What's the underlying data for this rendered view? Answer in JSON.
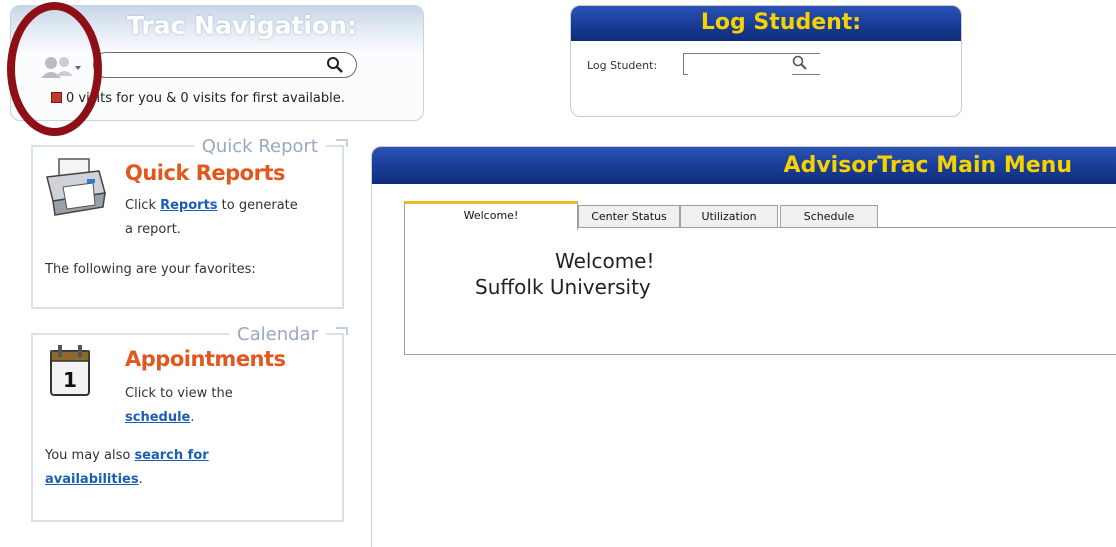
{
  "trac_nav": {
    "title": "Trac Navigation:",
    "search": {
      "value": "",
      "placeholder": ""
    },
    "visits_text": "0 visits for you & 0 visits for first available."
  },
  "log_student": {
    "title": "Log Student:",
    "label": "Log Student:",
    "input": {
      "value": "",
      "placeholder": ""
    }
  },
  "quick_report": {
    "legend": "Quick Report",
    "heading": "Quick Reports",
    "line1_pre": "Click ",
    "link": "Reports",
    "line1_post": " to generate",
    "line2": "a report.",
    "favorites": "The following are your favorites:"
  },
  "calendar": {
    "legend": "Calendar",
    "heading": "Appointments",
    "icon_day": "1",
    "line1": "Click to view the",
    "link_schedule": "schedule",
    "period": ".",
    "also_pre": "You may also ",
    "link_search_1": "search for",
    "link_search_2": "availabilities",
    "period2": "."
  },
  "main_menu": {
    "title": "AdvisorTrac Main Menu",
    "tabs": [
      {
        "label": "Welcome!",
        "active": true
      },
      {
        "label": "Center Status",
        "active": false
      },
      {
        "label": "Utilization",
        "active": false
      },
      {
        "label": "Schedule",
        "active": false
      }
    ],
    "welcome": "Welcome!",
    "org": "Suffolk University"
  },
  "colors": {
    "header_blue": "#173a93",
    "header_text_yellow": "#f5d200",
    "heading_orange": "#e2571e",
    "link_blue": "#1a5fb4",
    "annotation_red": "#8e0f15",
    "active_tab_accent": "#f3b62b"
  },
  "icons": [
    "user-icon",
    "search-icon",
    "visits-icon",
    "printer-icon",
    "calendar-icon"
  ]
}
